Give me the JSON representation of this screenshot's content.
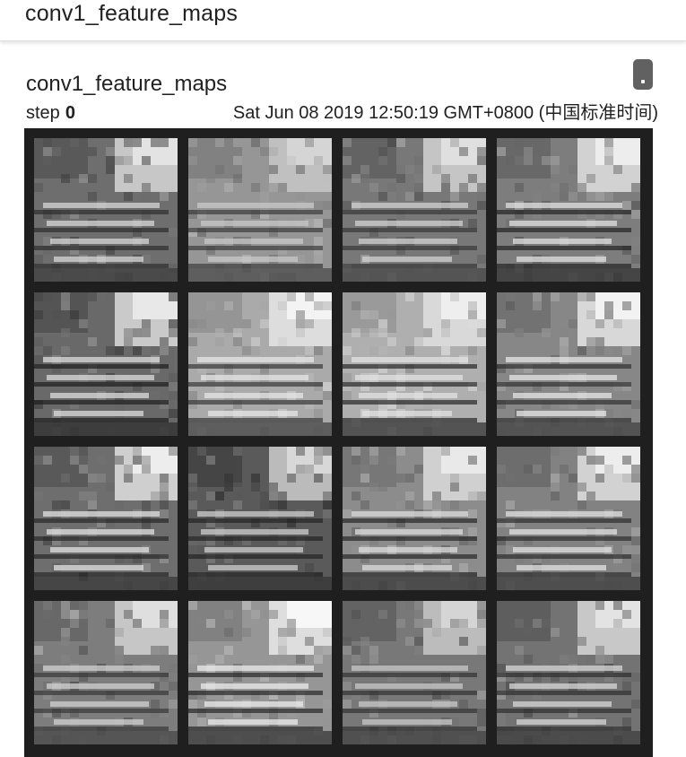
{
  "section": {
    "title": "conv1_feature_maps"
  },
  "card": {
    "title": "conv1_feature_maps",
    "step_label": "step",
    "step_value": "0",
    "timestamp": "Sat Jun 08 2019 12:50:19 GMT+0800 (中国标准时间)",
    "menu_icon": "more-vert-icon"
  },
  "image": {
    "grid_rows": 4,
    "grid_cols": 4,
    "tile_count": 16
  }
}
